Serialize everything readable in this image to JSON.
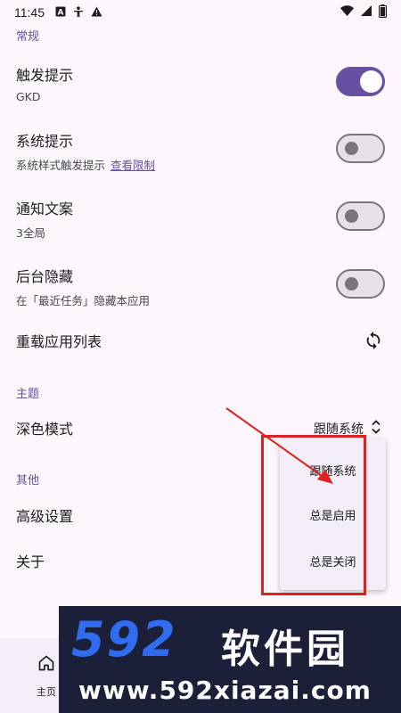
{
  "status_bar": {
    "time": "11:45"
  },
  "sections": {
    "general": "常规",
    "theme": "主题",
    "other": "其他"
  },
  "settings": {
    "trigger_hint": {
      "title": "触发提示",
      "subtitle": "GKD",
      "on": true
    },
    "system_hint": {
      "title": "系统提示",
      "subtitle": "系统样式触发提示",
      "link": "查看限制",
      "on": false
    },
    "notify_text": {
      "title": "通知文案",
      "subtitle": "3全局",
      "on": false
    },
    "bg_hide": {
      "title": "后台隐藏",
      "subtitle": "在「最近任务」隐藏本应用",
      "on": false
    },
    "reload_apps": {
      "title": "重载应用列表"
    },
    "dark_mode": {
      "title": "深色模式",
      "value": "跟随系统"
    },
    "advanced": {
      "title": "高级设置"
    },
    "about": {
      "title": "关于"
    }
  },
  "dropdown": {
    "options": [
      "跟随系统",
      "总是启用",
      "总是关闭"
    ]
  },
  "bottom_nav": {
    "home_label": "主页"
  },
  "watermark": {
    "number": "592",
    "brand": "软件园",
    "url": "www.592xiazai.com"
  },
  "colors": {
    "accent": "#6750a4",
    "annotation_red": "#e02020"
  }
}
